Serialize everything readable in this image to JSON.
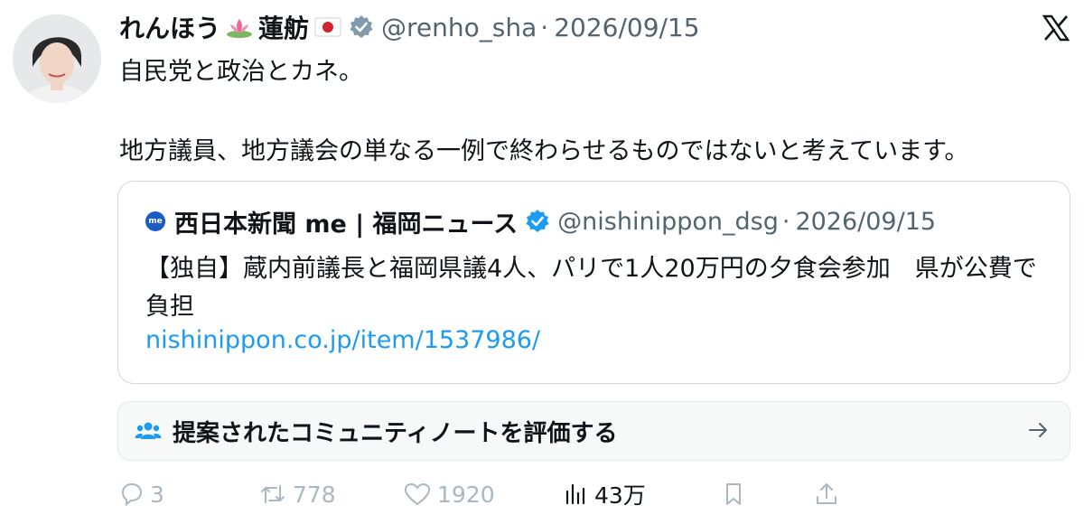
{
  "tweet": {
    "display_name": "れんほう",
    "display_name_2": "蓮舫",
    "name_emoji_1": "lotus-icon",
    "name_emoji_2": "japan-flag-icon",
    "handle": "@renho_sha",
    "separator": "·",
    "date": "2026/09/15",
    "text": "自民党と政治とカネ。\n\n地方議員、地方議会の単なる一例で終わらせるものではないと考えています。"
  },
  "quote": {
    "name": "西日本新聞 me | 福岡ニュース",
    "handle": "@nishinippon_dsg",
    "separator": "·",
    "date": "2026/09/15",
    "text": "【独自】蔵内前議長と福岡県議4人、パリで1人20万円の夕食会参加　県が公費で負担",
    "link": "nishinippon.co.jp/item/1537986/"
  },
  "community_note": {
    "label": "提案されたコミュニティノートを評価する"
  },
  "actions": {
    "replies": "3",
    "retweets": "778",
    "likes": "1920",
    "views": "43万"
  },
  "colors": {
    "verified": "#829aab",
    "verified_quote": "#1d9bf0",
    "link": "#1d9bf0",
    "muted": "#536471"
  }
}
